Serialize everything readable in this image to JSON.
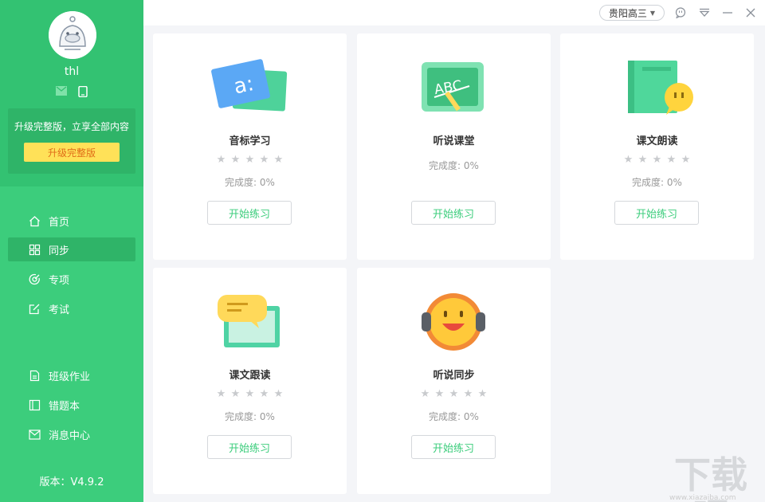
{
  "user": {
    "name": "thl"
  },
  "upgrade": {
    "text": "升级完整版，立享全部内容",
    "button": "升级完整版"
  },
  "nav": {
    "main": [
      {
        "label": "首页",
        "icon": "home-icon",
        "active": false
      },
      {
        "label": "同步",
        "icon": "grid-icon",
        "active": true
      },
      {
        "label": "专项",
        "icon": "target-icon",
        "active": false
      },
      {
        "label": "考试",
        "icon": "exam-edit-icon",
        "active": false
      }
    ],
    "secondary": [
      {
        "label": "班级作业",
        "icon": "homework-icon"
      },
      {
        "label": "错题本",
        "icon": "notebook-icon"
      },
      {
        "label": "消息中心",
        "icon": "mail-icon"
      }
    ]
  },
  "version": "版本：V4.9.2",
  "titlebar": {
    "region": "贵阳高三"
  },
  "cards": [
    {
      "title": "音标学习",
      "progress": "完成度: 0%",
      "button": "开始练习",
      "stars": 5,
      "illustration": "phonetic-card-icon"
    },
    {
      "title": "听说课堂",
      "progress": "完成度: 0%",
      "button": "开始练习",
      "stars": 0,
      "illustration": "chalkboard-abc-icon"
    },
    {
      "title": "课文朗读",
      "progress": "完成度: 0%",
      "button": "开始练习",
      "stars": 5,
      "illustration": "book-speech-icon"
    },
    {
      "title": "课文跟读",
      "progress": "完成度: 0%",
      "button": "开始练习",
      "stars": 5,
      "illustration": "chat-bubble-icon"
    },
    {
      "title": "听说同步",
      "progress": "完成度: 0%",
      "button": "开始练习",
      "stars": 5,
      "illustration": "headphone-face-icon"
    }
  ],
  "colors": {
    "primary": "#3ccd7c",
    "sidebar_dark": "#2fb468",
    "upgrade_button": "#ffe158"
  },
  "watermark": {
    "text": "下载吧",
    "sub": "www.xiazaiba.com"
  }
}
